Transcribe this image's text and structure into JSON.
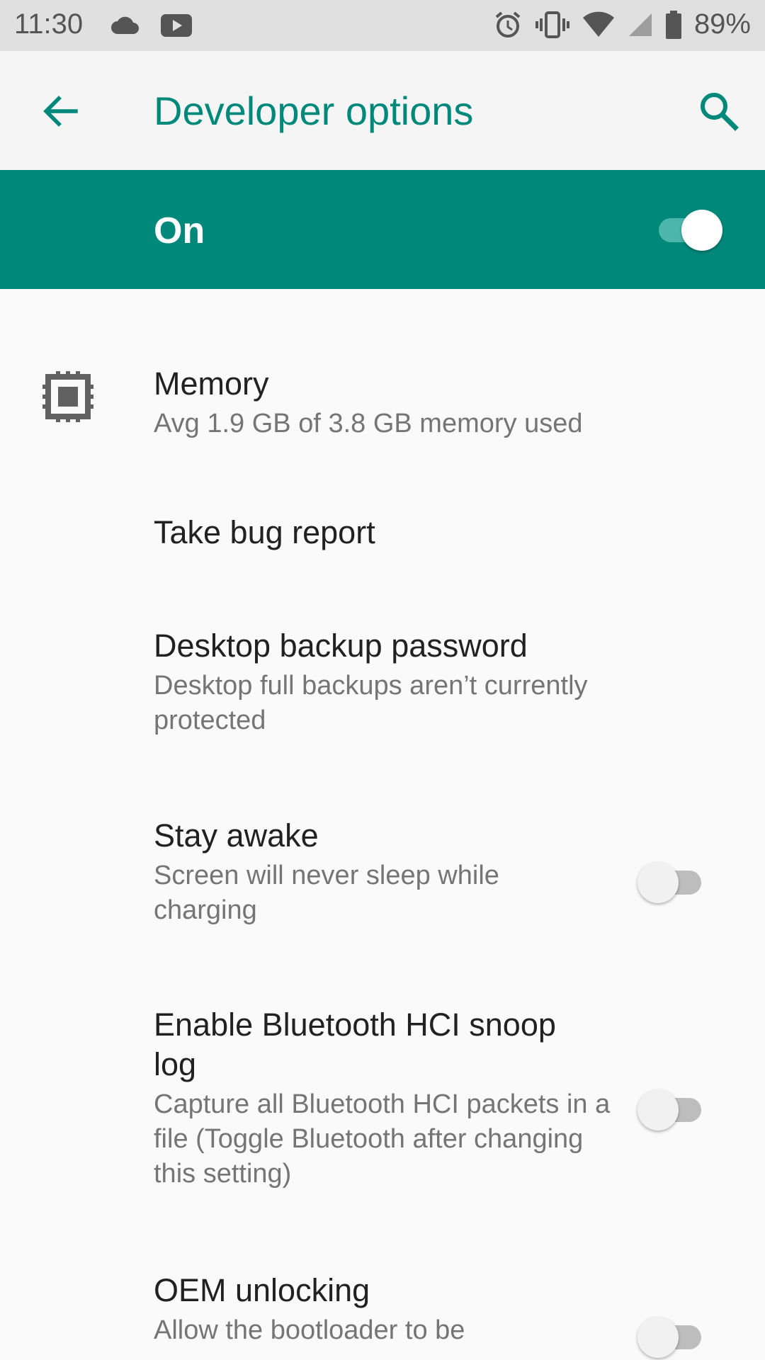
{
  "status_bar": {
    "time": "11:30",
    "battery_percent": "89%",
    "icons": [
      "cloud-icon",
      "youtube-icon",
      "alarm-icon",
      "vibrate-icon",
      "wifi-icon",
      "signal-icon",
      "battery-icon"
    ]
  },
  "app_bar": {
    "title": "Developer options",
    "back_icon": "arrow-back-icon",
    "search_icon": "search-icon",
    "accent_color": "#00897b"
  },
  "master_switch": {
    "label": "On",
    "checked": true,
    "background_color": "#00897b"
  },
  "settings": [
    {
      "title": "Memory",
      "summary": "Avg 1.9 GB of 3.8 GB memory used",
      "icon": "memory-chip-icon"
    },
    {
      "title": "Take bug report"
    },
    {
      "title": "Desktop backup password",
      "summary": "Desktop full backups aren’t currently protected"
    },
    {
      "title": "Stay awake",
      "summary": "Screen will never sleep while charging",
      "toggle": false
    },
    {
      "title": "Enable Bluetooth HCI snoop log",
      "summary": "Capture all Bluetooth HCI packets in a file (Toggle Bluetooth after changing this setting)",
      "toggle": false
    },
    {
      "title": "OEM unlocking",
      "summary": "Allow the bootloader to be",
      "toggle": false
    }
  ]
}
